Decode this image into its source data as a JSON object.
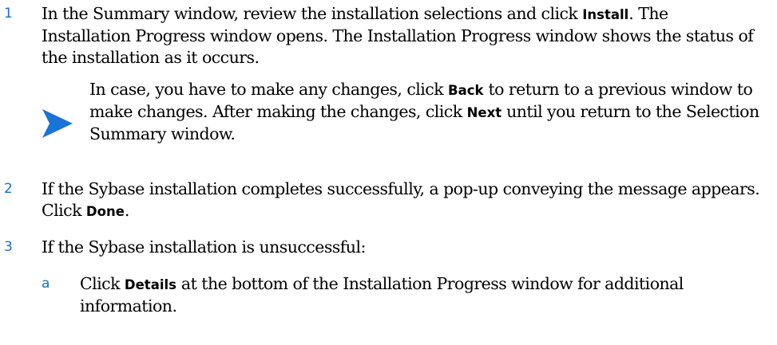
{
  "steps": [
    {
      "number": "1",
      "text_a": "In the Summary window, review the installation selections and click ",
      "bold_a": "Install",
      "text_b": ". The Installation Progress window opens. The Installation Progress window shows the status of the installation as it occurs."
    },
    {
      "number": "2",
      "text_a": "If the Sybase installation completes successfully, a pop-up conveying the message appears. Click ",
      "bold_a": "Done",
      "text_b": "."
    },
    {
      "number": "3",
      "text_a": "If the Sybase installation is unsuccessful:"
    }
  ],
  "note": {
    "icon": "arrow-note-icon",
    "text_a": "In case, you have to make any changes, click ",
    "bold_a": "Back",
    "text_b": " to return to a previous window to make changes. After making the changes, click ",
    "bold_b": "Next",
    "text_c": " until you return to the Selection Summary window."
  },
  "substeps": [
    {
      "letter": "a",
      "text_a": "Click ",
      "bold_a": "Details",
      "text_b": " at the bottom of the Installation Progress window for additional information."
    }
  ],
  "colors": {
    "number": "#1a6fc0",
    "icon": "#1a73d6"
  }
}
